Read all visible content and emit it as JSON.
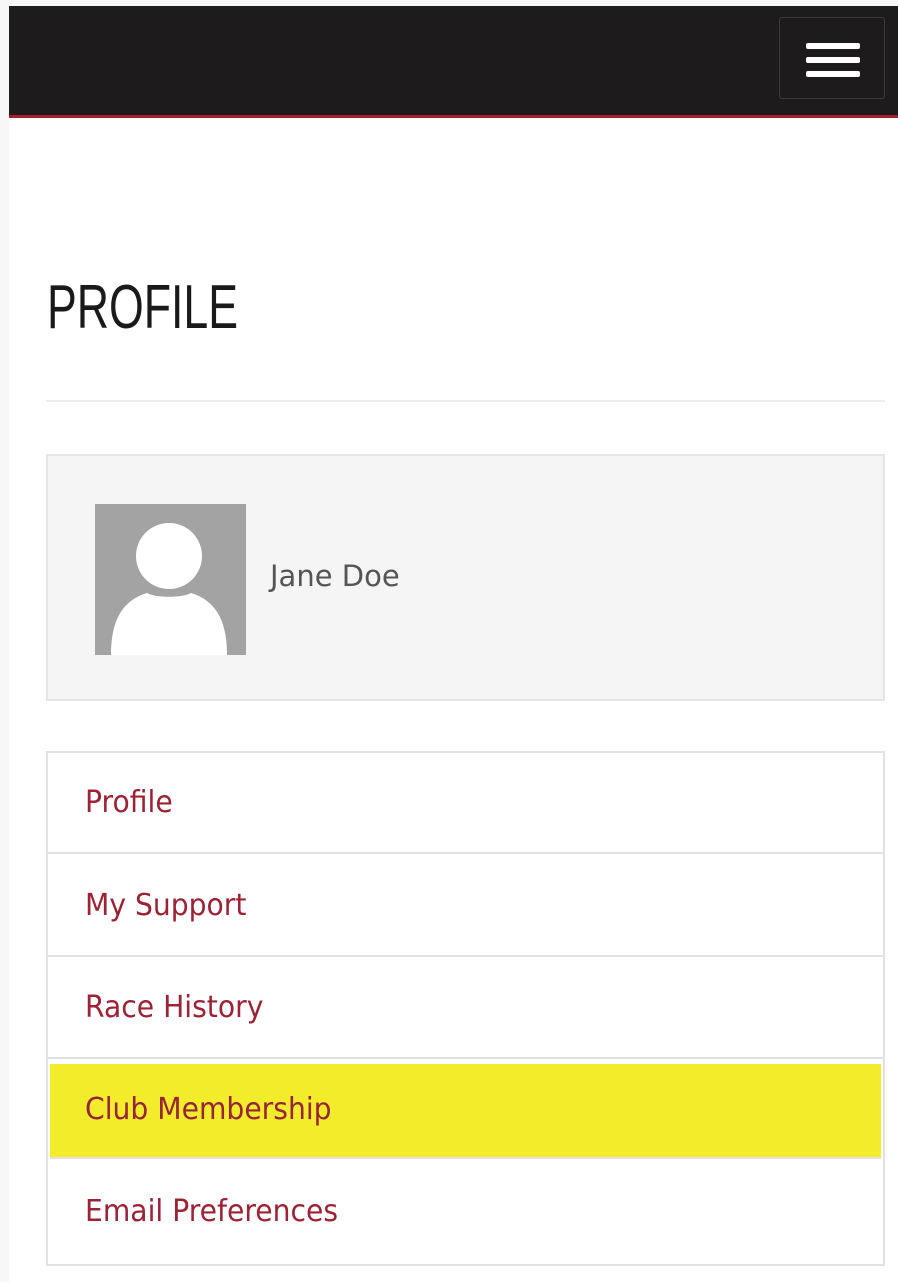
{
  "header": {
    "menu_icon": "hamburger-menu-icon",
    "colors": {
      "background": "#1d1b1c",
      "accent_line": "#a3202a"
    }
  },
  "page": {
    "title": "PROFILE"
  },
  "user": {
    "name": "Jane Doe",
    "avatar_icon": "default-avatar-icon"
  },
  "nav": {
    "items": [
      {
        "label": "Profile",
        "highlighted": false
      },
      {
        "label": "My Support",
        "highlighted": false
      },
      {
        "label": "Race History",
        "highlighted": false
      },
      {
        "label": "Club Membership",
        "highlighted": true
      },
      {
        "label": "Email Preferences",
        "highlighted": false
      }
    ],
    "colors": {
      "link": "#9c2236",
      "highlight": "#f3ec2b"
    }
  }
}
